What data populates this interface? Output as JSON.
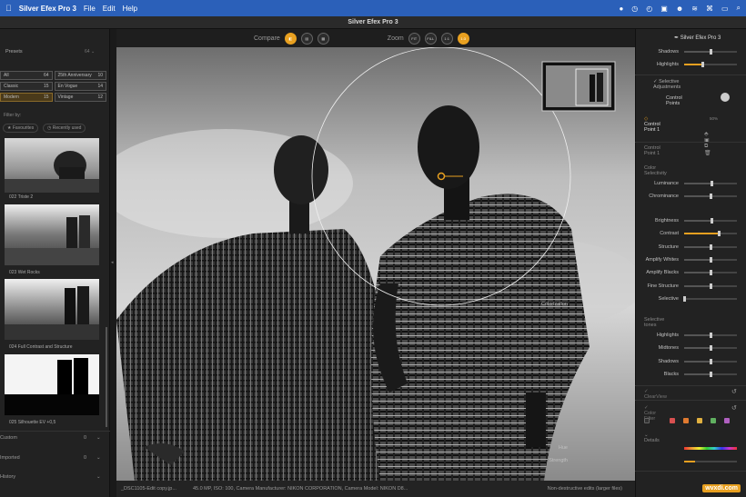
{
  "menubar": {
    "apple": "",
    "app": "Silver Efex Pro 3",
    "items": [
      "File",
      "Edit",
      "Help"
    ],
    "time": "—"
  },
  "window": {
    "title": "Silver Efex Pro 3"
  },
  "left": {
    "presets_header": "Presets",
    "table": [
      [
        {
          "label": "All",
          "count": "64"
        },
        {
          "label": "25th Anniversary",
          "count": "10"
        }
      ],
      [
        {
          "label": "Classic",
          "count": "15"
        },
        {
          "label": "En Vogue",
          "count": "14"
        }
      ],
      [
        {
          "label": "Modern",
          "count": "15"
        },
        {
          "label": "Vintage",
          "count": "12"
        }
      ]
    ],
    "filter_by": "Filter by:",
    "filters": [
      "★ Favourites",
      "◷ Recently used"
    ],
    "thumbs": [
      "022 Triste 2",
      "023 Wet Rocks",
      "024 Full Contrast and Structure",
      "025 Silhouette EV +0,5"
    ],
    "bottom": [
      {
        "label": "Custom",
        "count": "0"
      },
      {
        "label": "Imported",
        "count": "0"
      },
      {
        "label": "History",
        "count": ""
      }
    ]
  },
  "toolbar": {
    "compare": "Compare",
    "zoom": "Zoom",
    "zoom_options": [
      "FIT",
      "FILL",
      "1:1",
      "1:3"
    ]
  },
  "status": {
    "file": "_DSC1105-Edit copy.jp...",
    "meta": "45.0 MP, ISO: 100, Camera Manufacturer: NIKON CORPORATION, Camera Model: NIKON D8...",
    "edits": "Non-destructive edits (larger files)"
  },
  "right": {
    "header": "Silver Efex Pro 3",
    "top_sliders": [
      {
        "label": "Shadows",
        "value": 0.5
      },
      {
        "label": "Highlights",
        "value": 0.35
      }
    ],
    "selective_adjustments": "Selective Adjustments",
    "control_points": "Control Points",
    "cp_item": "Control Point 1",
    "cp_pct": "50%",
    "cp_section": "Control Point 1",
    "color_selectivity": "Color Selectivity",
    "cs_sliders": [
      {
        "label": "Luminance",
        "value": 0.52
      },
      {
        "label": "Chrominance",
        "value": 0.5
      }
    ],
    "main_sliders": [
      {
        "label": "Brightness",
        "value": 0.52
      },
      {
        "label": "Contrast",
        "value": 0.66
      },
      {
        "label": "Structure",
        "value": 0.5
      },
      {
        "label": "Amplify Whites",
        "value": 0.5
      },
      {
        "label": "Amplify Blacks",
        "value": 0.5
      },
      {
        "label": "Fine Structure",
        "value": 0.5
      },
      {
        "label": "Selective",
        "value": 0.0
      }
    ],
    "selective_colorization": "Colorization",
    "selective_tones": "Selective tones",
    "tone_sliders": [
      {
        "label": "Highlights",
        "value": 0.5
      },
      {
        "label": "Midtones",
        "value": 0.5
      },
      {
        "label": "Shadows",
        "value": 0.5
      },
      {
        "label": "Blacks",
        "value": 0.5
      }
    ],
    "clearview": "ClearView",
    "color_filter": "Color Filter",
    "swatch_colors": [
      "#d85050",
      "#e07a30",
      "#e0b040",
      "#60b060",
      "#b060c0"
    ],
    "details": "Details",
    "hue": "Hue",
    "strength": "Strength",
    "strength_value": 0.2
  },
  "watermark": "wvxdi.com"
}
